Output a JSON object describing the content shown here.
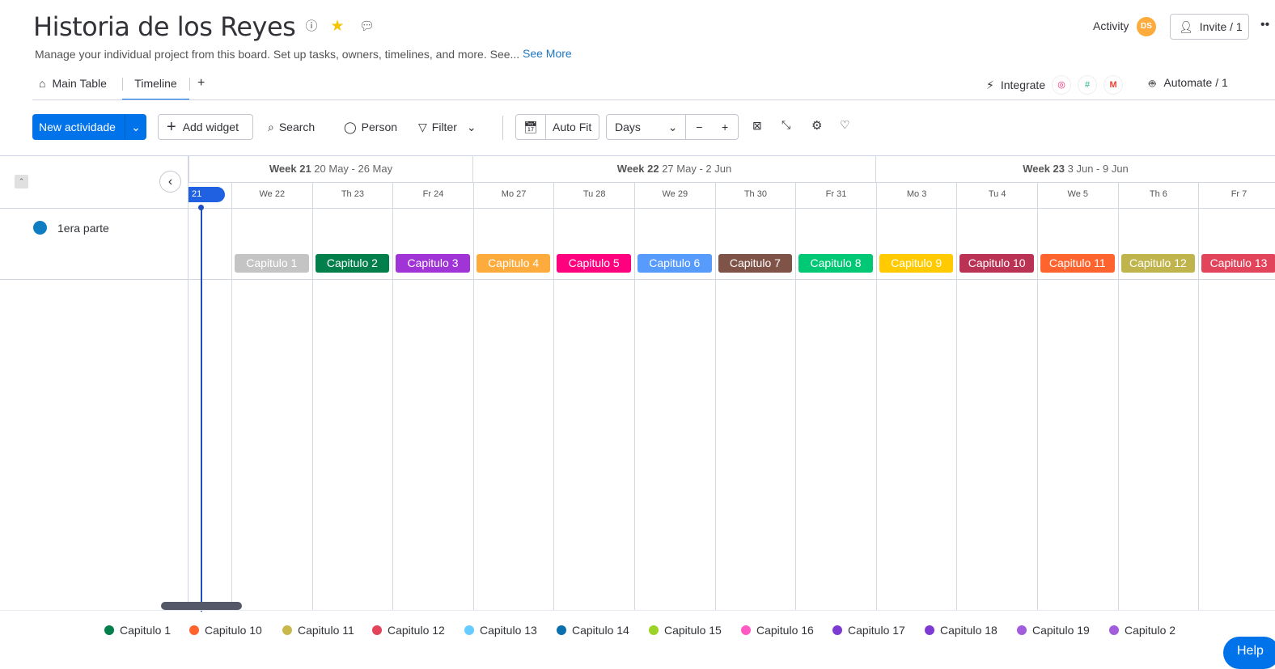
{
  "header": {
    "title": "Historia de los Reyes",
    "description": "Manage your individual project from this board. Set up tasks, owners, timelines, and more. See...",
    "see_more": "See More",
    "activity": "Activity",
    "avatar_initials": "DS",
    "invite": "Invite / 1",
    "integrate": "Integrate",
    "automate": "Automate / 1"
  },
  "tabs": [
    {
      "label": "Main Table"
    },
    {
      "label": "Timeline"
    },
    {
      "label": "+"
    }
  ],
  "toolbar": {
    "new_item": "New actividade",
    "add_widget": "Add widget",
    "search": "Search",
    "person": "Person",
    "filter": "Filter",
    "auto_fit": "Auto Fit",
    "zoom_unit": "Days",
    "minus": "−",
    "plus": "+"
  },
  "timeline": {
    "today": "21",
    "weeks": [
      {
        "label": "Week 21",
        "range": "20 May - 26 May"
      },
      {
        "label": "Week 22",
        "range": "27 May - 2 Jun"
      },
      {
        "label": "Week 23",
        "range": "3 Jun - 9 Jun"
      }
    ],
    "days": [
      "We 22",
      "Th 23",
      "Fr 24",
      "Mo 27",
      "Tu 28",
      "We 29",
      "Th 30",
      "Fr 31",
      "Mo 3",
      "Tu 4",
      "We 5",
      "Th 6",
      "Fr 7"
    ],
    "group": {
      "name": "1era parte",
      "color": "#0f7dc1"
    },
    "items": [
      {
        "label": "Capitulo 1",
        "color": "#c4c4c4"
      },
      {
        "label": "Capitulo 2",
        "color": "#037f4c"
      },
      {
        "label": "Capitulo 3",
        "color": "#a034d6"
      },
      {
        "label": "Capitulo 4",
        "color": "#fdab3d"
      },
      {
        "label": "Capitulo 5",
        "color": "#ff007f"
      },
      {
        "label": "Capitulo 6",
        "color": "#579bfc"
      },
      {
        "label": "Capitulo 7",
        "color": "#7f5347"
      },
      {
        "label": "Capitulo 8",
        "color": "#00c875"
      },
      {
        "label": "Capitulo 9",
        "color": "#ffcb00"
      },
      {
        "label": "Capitulo 10",
        "color": "#bb3354"
      },
      {
        "label": "Capitulo 11",
        "color": "#ff642e"
      },
      {
        "label": "Capitulo 12",
        "color": "#c0b44c"
      },
      {
        "label": "Capitulo 13",
        "color": "#e2445c"
      }
    ]
  },
  "legend": [
    {
      "label": "Capitulo 1",
      "color": "#037f4c"
    },
    {
      "label": "Capitulo 10",
      "color": "#ff642e"
    },
    {
      "label": "Capitulo 11",
      "color": "#c9b84c"
    },
    {
      "label": "Capitulo 12",
      "color": "#e2445c"
    },
    {
      "label": "Capitulo 13",
      "color": "#66ccff"
    },
    {
      "label": "Capitulo 14",
      "color": "#0a6fad"
    },
    {
      "label": "Capitulo 15",
      "color": "#9cd326"
    },
    {
      "label": "Capitulo 16",
      "color": "#ff5ac4"
    },
    {
      "label": "Capitulo 17",
      "color": "#7e3bd4"
    },
    {
      "label": "Capitulo 18",
      "color": "#7e3bd4"
    },
    {
      "label": "Capitulo 19",
      "color": "#a25ddc"
    },
    {
      "label": "Capitulo 2",
      "color": "#a25ddc"
    }
  ],
  "help": "Help"
}
